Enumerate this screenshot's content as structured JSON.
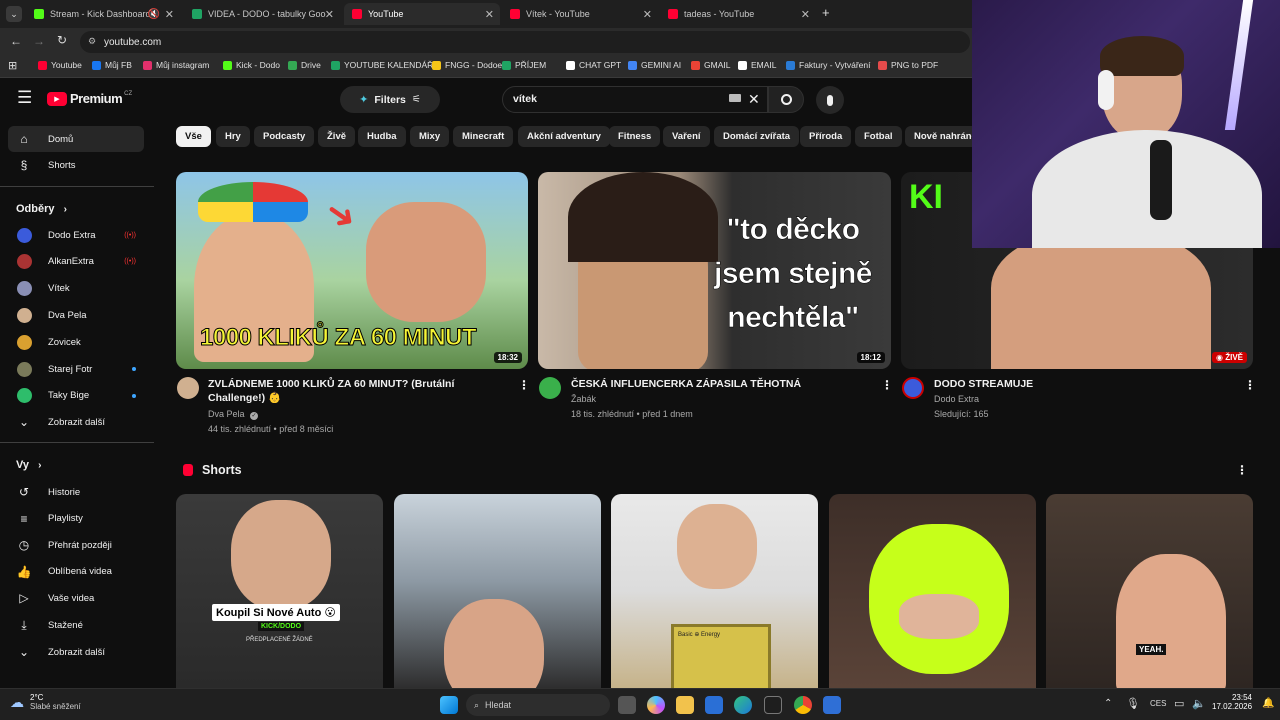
{
  "browser": {
    "tabs": [
      {
        "label": "Stream - Kick Dashboard",
        "color": "#53fc18"
      },
      {
        "label": "VIDEA - DODO - tabulky Googl",
        "color": "#1fa463"
      },
      {
        "label": "YouTube",
        "color": "#ff0033",
        "active": true
      },
      {
        "label": "Vítek - YouTube",
        "color": "#ff0033"
      },
      {
        "label": "tadeas - YouTube",
        "color": "#ff0033"
      }
    ],
    "new_tab": "+",
    "url": "youtube.com",
    "bookmarks": [
      {
        "label": "Youtube",
        "color": "#ff0033"
      },
      {
        "label": "Můj FB",
        "color": "#1877f2"
      },
      {
        "label": "Můj instagram",
        "color": "#e1306c"
      },
      {
        "label": "Kick - Dodo",
        "color": "#53fc18"
      },
      {
        "label": "Drive",
        "color": "#34a853"
      },
      {
        "label": "YOUTUBE KALENDÁŘ",
        "color": "#1fa463"
      },
      {
        "label": "FNGG - Dodoeu",
        "color": "#f5c518"
      },
      {
        "label": "PŘÍJEM",
        "color": "#1fa463"
      },
      {
        "label": "CHAT GPT",
        "color": "#ffffff"
      },
      {
        "label": "GEMINI AI",
        "color": "#4285f4"
      },
      {
        "label": "GMAIL",
        "color": "#ea4335"
      },
      {
        "label": "EMAIL",
        "color": "#ffffff"
      },
      {
        "label": "Faktury - Vytváření",
        "color": "#2a7bd5"
      },
      {
        "label": "PNG to PDF",
        "color": "#e54b4b"
      }
    ]
  },
  "youtube": {
    "logo_text": "Premium",
    "logo_sup": "CZ",
    "filters_label": "Filters",
    "search_value": "vítek",
    "chips": [
      "Vše",
      "Hry",
      "Podcasty",
      "Živě",
      "Hudba",
      "Mixy",
      "Minecraft",
      "Akční adventury",
      "Fitness",
      "Vaření",
      "Domácí zvířata",
      "Příroda",
      "Fotbal",
      "Nově nahráno"
    ],
    "sidebar": {
      "home": "Domů",
      "shorts": "Shorts",
      "subs_heading": "Odběry",
      "subscriptions": [
        {
          "name": "Dodo Extra",
          "color": "#3b5bdb",
          "status": "live"
        },
        {
          "name": "AlkanExtra",
          "color": "#a33",
          "status": "live"
        },
        {
          "name": "Vítek",
          "color": "#8a8fb5",
          "status": ""
        },
        {
          "name": "Dva Pela",
          "color": "#d0b090",
          "status": ""
        },
        {
          "name": "Zovicek",
          "color": "#d9a030",
          "status": ""
        },
        {
          "name": "Starej Fotr",
          "color": "#7a7a5a",
          "status": "new"
        },
        {
          "name": "Taky Bige",
          "color": "#2ebd6b",
          "status": "new"
        }
      ],
      "show_more": "Zobrazit další",
      "you_heading": "Vy",
      "you_items": [
        "Historie",
        "Playlisty",
        "Přehrát později",
        "Oblíbená videa",
        "Vaše videa",
        "Stažené"
      ],
      "show_more_2": "Zobrazit další"
    },
    "videos": [
      {
        "title": "ZVLÁDNEME 1000 KLIKŮ ZA 60 MINUT? (Brutální Challenge!) 👶",
        "channel": "Dva Pela",
        "verified": true,
        "meta": "44 tis. zhlédnutí • před 8 měsíci",
        "duration": "18:32",
        "thumb_text": "1000 KLIKŮ ZA 60 MINUT"
      },
      {
        "title": "ČESKÁ INFLUENCERKA ZÁPASILA TĚHOTNÁ",
        "channel": "Žabák",
        "verified": false,
        "meta": "18 tis. zhlédnutí • před 1 dnem",
        "duration": "18:12",
        "thumb_text": "\"to děcko jsem stejně nechtěla\""
      },
      {
        "title": "DODO STREAMUJE",
        "channel": "Dodo Extra",
        "verified": false,
        "meta": "Sledující: 165",
        "duration": "ŽIVĚ",
        "thumb_text": "KI"
      }
    ],
    "shorts_heading": "Shorts",
    "shorts": [
      {
        "caption": "Koupil Si Nové Auto 😮",
        "sub": "KICK/DODO",
        "sub2": "PŘEDPLACENÉ ŽÁDNÉ"
      },
      {
        "caption": "",
        "sub": "",
        "sub2": ""
      },
      {
        "caption": "",
        "sub": "Basic ⊕ Energy",
        "sub2": ""
      },
      {
        "caption": "",
        "sub": "",
        "sub2": ""
      },
      {
        "caption": "",
        "sub": "YEAH.",
        "sub2": ""
      }
    ]
  },
  "taskbar": {
    "weather_temp": "2°C",
    "weather_desc": "Slabé sněžení",
    "search_placeholder": "Hledat",
    "lang": "CES",
    "time": "23:54",
    "date": "17.02.2026"
  }
}
